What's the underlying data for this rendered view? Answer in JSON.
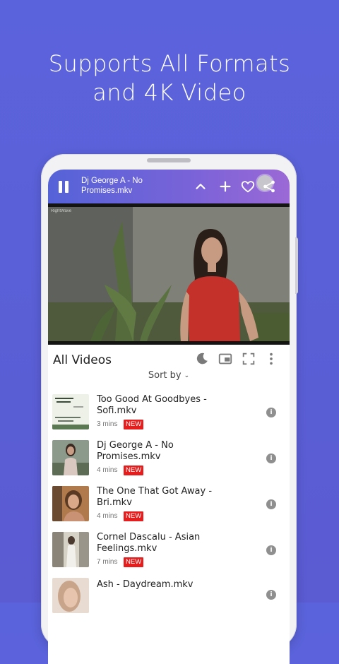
{
  "headline": {
    "line1": "Supports All Formats",
    "line2": "and 4K Video"
  },
  "player": {
    "track_title": "Dj George A - No Promises.mkv",
    "icons": [
      "pause-icon",
      "chevron-up-icon",
      "plus-icon",
      "heart-icon",
      "share-icon"
    ],
    "watermark": "RightWave"
  },
  "list": {
    "title": "All Videos",
    "sort_label": "Sort by",
    "sort_chevron": "⌄",
    "header_icons": [
      "moon-icon",
      "picture-in-picture-icon",
      "fullscreen-icon",
      "more-vertical-icon"
    ],
    "items": [
      {
        "title": "Too Good At Goodbyes - Sofi.mkv",
        "duration": "3 mins",
        "badge": "NEW",
        "info": "i"
      },
      {
        "title": "Dj George A - No Promises.mkv",
        "duration": "4 mins",
        "badge": "NEW",
        "info": "i"
      },
      {
        "title": "The One That Got Away - Bri.mkv",
        "duration": "4 mins",
        "badge": "NEW",
        "info": "i"
      },
      {
        "title": "Cornel Dascalu - Asian Feelings.mkv",
        "duration": "7 mins",
        "badge": "NEW",
        "info": "i"
      },
      {
        "title": "Ash - Daydream.mkv",
        "duration": "",
        "badge": "",
        "info": "i"
      }
    ]
  },
  "colors": {
    "background": "#5b63dc",
    "player_bar_start": "#5563d8",
    "player_bar_end": "#9b69d6",
    "badge": "#e51d1d"
  }
}
